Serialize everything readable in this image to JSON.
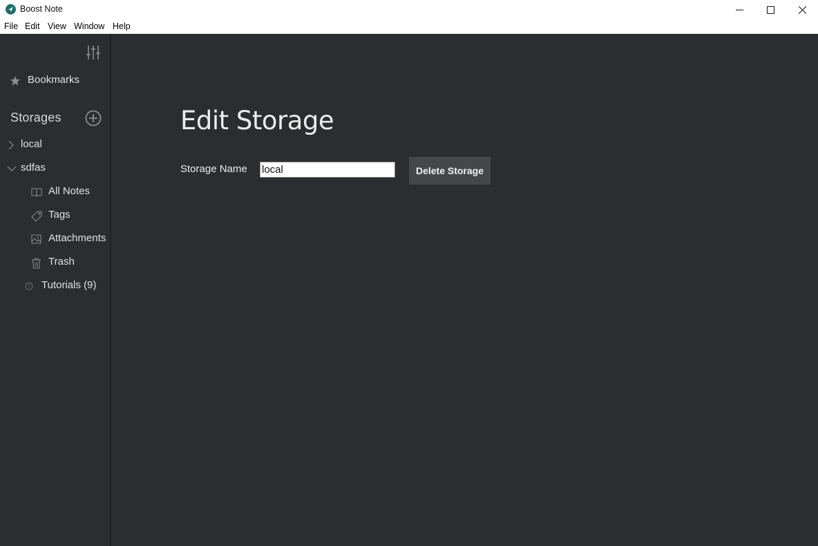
{
  "window": {
    "title": "Boost Note"
  },
  "menu": {
    "items": [
      "File",
      "Edit",
      "View",
      "Window",
      "Help"
    ]
  },
  "sidebar": {
    "bookmarks_label": "Bookmarks",
    "storages_label": "Storages",
    "storages": [
      {
        "name": "local",
        "expanded": false
      },
      {
        "name": "sdfas",
        "expanded": true
      }
    ],
    "sub_items": [
      {
        "label": "All Notes",
        "icon": "book-icon"
      },
      {
        "label": "Tags",
        "icon": "tag-icon"
      },
      {
        "label": "Attachments",
        "icon": "image-icon"
      },
      {
        "label": "Trash",
        "icon": "trash-icon"
      }
    ],
    "tutorials_label": "Tutorials (9)"
  },
  "main": {
    "title": "Edit Storage",
    "storage_name_label": "Storage Name",
    "storage_name_value": "local",
    "delete_button_label": "Delete Storage"
  },
  "colors": {
    "background": "#2c2d30",
    "button_bg": "#46474b",
    "app_icon": "#1d6f6a"
  }
}
